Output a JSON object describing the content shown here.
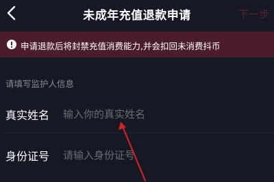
{
  "nav": {
    "back_icon": "chevron-left-icon",
    "title": "未成年充值退款申请",
    "next_label": "下一步"
  },
  "notice": {
    "icon": "exclamation-circle-icon",
    "text": "申请退款后将封禁充值消费能力,并会扣回未消费抖币"
  },
  "form": {
    "section_label": "请填写监护人信息",
    "fields": [
      {
        "label": "真实姓名",
        "placeholder": "输入你的真实姓名",
        "value": ""
      },
      {
        "label": "身份证号",
        "placeholder": "请输入身份证号",
        "value": ""
      }
    ]
  },
  "annotation": {
    "arrow": "red-arrow-icon"
  },
  "colors": {
    "background": "#161823",
    "notice_background": "#4a1c2c",
    "next_disabled": "#5a2234",
    "placeholder": "#6b6c73",
    "arrow": "#d0202a"
  }
}
